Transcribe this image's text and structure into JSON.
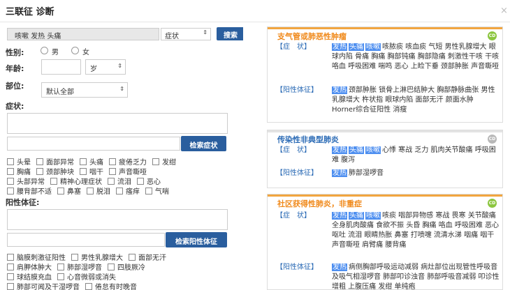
{
  "window": {
    "title": "三联征 诊断",
    "close_glyph": "×"
  },
  "search": {
    "query": "咳嗽 发热 头痛",
    "type_value": "症状",
    "button": "搜索"
  },
  "gender": {
    "label": "性别:",
    "male": "男",
    "female": "女"
  },
  "age": {
    "label": "年龄:",
    "unit": "岁"
  },
  "part": {
    "label": "部位:",
    "value": "默认全部"
  },
  "symptoms": {
    "label": "症状:",
    "button": "检索症状",
    "rows": [
      [
        "头晕",
        "面部异常",
        "头痛",
        "疲倦乏力",
        "发绀"
      ],
      [
        "胸痛",
        "颈部肿块",
        "咽干",
        "声音嘶哑"
      ],
      [
        "头部异常",
        "精神心理症状",
        "流泪",
        "恶心"
      ],
      [
        "腰背部不适",
        "鼻塞",
        "脱泪",
        "瘙痒",
        "气喘"
      ]
    ]
  },
  "signs": {
    "label": "阳性体征:",
    "button": "检索阳性体征",
    "rows": [
      [
        "脑膜刺激征阳性",
        "男性乳腺增大",
        "面部无汗"
      ],
      [
        "肩胛体肿大",
        "肺部湿啰音",
        "四肢厥冷"
      ],
      [
        "球结膜充血",
        "心音微弱或消失"
      ],
      [
        "肺部可闻及干湿啰音",
        "倦怠有时晚音"
      ]
    ]
  },
  "results": [
    {
      "title": "支气管或肺恶性肿瘤",
      "title_color": "#f08a1c",
      "badge": "CD",
      "badge_color": "#8cc63f",
      "symptoms_label": "【症　状】",
      "symptoms_hl": [
        "发热",
        "头痛",
        "咳嗽"
      ],
      "symptoms_text": "咳脓痰 咳血痰 气短 男性乳腺增大 眼球内陷 骨痛 胸痛 胸部钝痛 胸部隐痛 刺激性干咳 干咳 咯血 呼吸困难 喘鸣 恶心 上睑下垂 颈部肿胀 声音嘶哑",
      "signs_label": "【阳性体征】",
      "signs_hl": [
        "发热"
      ],
      "signs_text": "颈部肿胀 锁骨上淋巴结肿大 胸部静脉曲张 男性乳腺增大 杵状指 眼球内陷 面部无汗 颜面水肿 Horner综合征阳性 消瘦"
    },
    {
      "title": "传染性非典型肺炎",
      "title_color": "#2a6ab5",
      "badge": "CD",
      "badge_color": "#b8b8b8",
      "symptoms_label": "【症　状】",
      "symptoms_hl": [
        "发热",
        "头痛",
        "咳嗽"
      ],
      "symptoms_text": "心悸 寒战 乏力 肌肉关节酸痛 呼吸困难 腹泻",
      "signs_label": "【阳性体征】",
      "signs_hl": [
        "发热"
      ],
      "signs_text": "肺部湿啰音"
    },
    {
      "title": "社区获得性肺炎，非重症",
      "title_color": "#f08a1c",
      "badge": "CD",
      "badge_color": "#8cc63f",
      "symptoms_label": "【症　状】",
      "symptoms_hl": [
        "发热",
        "头痛",
        "咳嗽"
      ],
      "symptoms_text": "咳痰 咽部异物感 寒战 畏寒 关节酸痛 全身肌肉酸痛 食欲不振 头昏 胸痛 咯血 呼吸困难 恶心 呕吐 流泪 眼睛热胀 鼻塞 打喷嚏 流清水涕 咽痛 咽干 声音嘶哑 肩臂痛 腰背痛",
      "signs_label": "【阳性体征】",
      "signs_hl": [
        "发热"
      ],
      "signs_text": "病侧胸部呼吸运动减弱 病灶部位出现管性呼吸音及吸气相湿啰音 肺部叩诊浊音 肺部呼吸音减弱 叩诊性增粗 上腹压痛 发绀 单纯疱"
    }
  ]
}
